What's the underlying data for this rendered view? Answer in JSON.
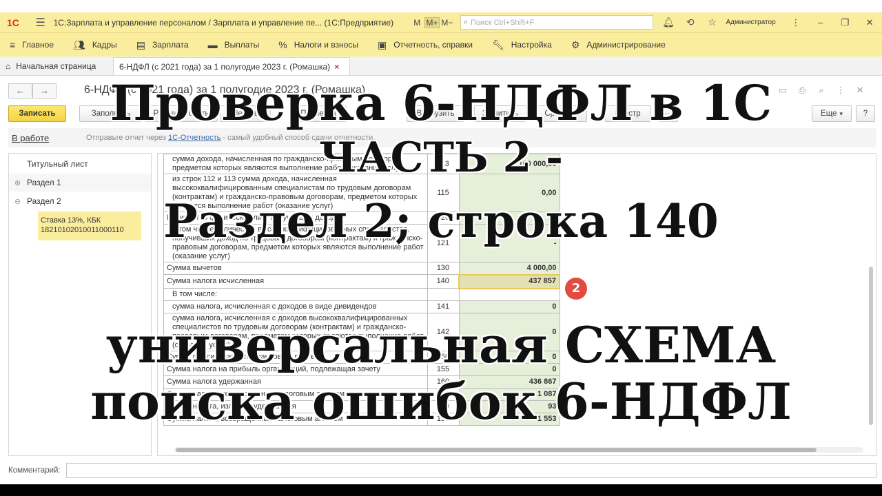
{
  "titlebar": {
    "logo": "1С",
    "title": "1С:Зарплата и управление персоналом / Зарплата и управление пе...  (1С:Предприятие)",
    "m_buttons": [
      "M",
      "M+",
      "M−"
    ],
    "search_placeholder": "Поиск Ctrl+Shift+F",
    "user": "Администратор"
  },
  "menu": {
    "items": [
      {
        "label": "Главное",
        "icon": "hamburger-icon"
      },
      {
        "label": "Кадры",
        "icon": "people-icon"
      },
      {
        "label": "Зарплата",
        "icon": "document-icon"
      },
      {
        "label": "Выплаты",
        "icon": "payment-icon"
      },
      {
        "label": "Налоги и взносы",
        "icon": "percent-icon"
      },
      {
        "label": "Отчетность, справки",
        "icon": "report-icon"
      },
      {
        "label": "Настройка",
        "icon": "wrench-icon"
      },
      {
        "label": "Администрирование",
        "icon": "gear-icon"
      }
    ]
  },
  "tabs": {
    "home": "Начальная страница",
    "active": "6-НДФЛ (с 2021 года) за 1 полугодие 2023 г. (Ромашка)"
  },
  "form": {
    "title": "6-НДФЛ (с 2021 года) за 1 полугодие 2023 г. (Ромашка)",
    "buttons": {
      "save": "Записать",
      "fill": "Заполнить",
      "calc": "Расшифровать",
      "print": "Печать",
      "check": "Проверка",
      "upload": "Выгрузить",
      "protect": "Защитить",
      "compare": "Сравнить",
      "registry": "Реестр",
      "more": "Еще",
      "help": "?"
    },
    "status": "В работе",
    "hint_prefix": "Отправьте отчет через ",
    "hint_link": "1С-Отчетность",
    "hint_suffix": " - самый удобный способ сдачи отчетности.",
    "comment_label": "Комментарий:"
  },
  "tree": {
    "items": [
      "Титульный лист",
      "Раздел 1",
      "Раздел 2"
    ],
    "selected": "Ставка 13%, КБК 18210102010011000110"
  },
  "table": {
    "rows": [
      {
        "label": "сумма дохода, начисленная по гражданско-правовым договорам, предметом которых являются выполнение работ (оказание услуг)",
        "code": "113",
        "value": "100 000,00"
      },
      {
        "label": "из строк 112 и 113 сумма дохода, начисленная высококвалифицированным специалистам по трудовым договорам (контрактам) и гражданско-правовым договорам, предметом которых являются выполнение работ (оказание услуг)",
        "code": "115",
        "value": "0,00"
      },
      {
        "label": "Количество физических лиц, получивших доход",
        "code": "120",
        "value": "14"
      },
      {
        "label": "в том числе количество высококвалифицированных специалистов, получивших доход по трудовым договорам (контрактам) и гражданско-правовым договорам, предметом которых являются выполнение работ (оказание услуг)",
        "code": "121",
        "value": "-"
      },
      {
        "label": "Сумма вычетов",
        "code": "130",
        "value": "4 000,00"
      },
      {
        "label": "Сумма налога исчисленная",
        "code": "140",
        "value": "437 857"
      },
      {
        "label": "В том числе:",
        "code": "",
        "value": ""
      },
      {
        "label": "сумма налога, исчисленная с доходов в виде дивидендов",
        "code": "141",
        "value": "0"
      },
      {
        "label": "сумма налога, исчисленная с доходов высококвалифицированных специалистов по трудовым договорам (контрактам) и гражданско-правовым договорам, предметом которых являются выполнение работ (оказание услуг)",
        "code": "142",
        "value": "0"
      },
      {
        "label": "Сумма фиксированного авансового платежа",
        "code": "150",
        "value": "0"
      },
      {
        "label": "Сумма налога на прибыль организаций, подлежащая зачету",
        "code": "155",
        "value": "0"
      },
      {
        "label": "Сумма налога удержанная",
        "code": "160",
        "value": "436 867"
      },
      {
        "label": "Сумма налога, не удержанная налоговым агентом",
        "code": "170",
        "value": "1 087"
      },
      {
        "label": "Сумма налога, излишне удержанная",
        "code": "180",
        "value": "93"
      },
      {
        "label": "Сумма налога, возвращенная налоговым агентом",
        "code": "190",
        "value": "1 553"
      }
    ],
    "marker": "2"
  },
  "overlay": {
    "line1": "Проверка 6-НДФЛ в 1С",
    "line2": "ЧАСТЬ 2 -",
    "line3": "Раздел 2; строка 140",
    "line4": "универсальная СХЕМА",
    "line5": "поиска ошибок 6-НДФЛ"
  },
  "colors": {
    "panel": "#fbed9e",
    "primary_button": "#f5d443",
    "value_cell": "#e6efd9",
    "marker": "#e24b3f"
  }
}
